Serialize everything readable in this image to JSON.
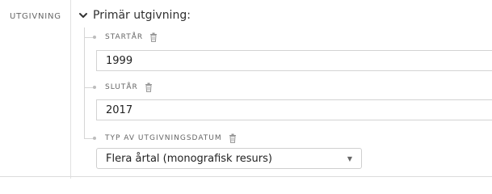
{
  "left": {
    "section_label": "UTGIVNING"
  },
  "section": {
    "title": "Primär utgivning:",
    "toggle_icon": "chevron-down-icon"
  },
  "fields": {
    "start_year": {
      "label": "STARTÅR",
      "value": "1999",
      "delete_icon": "trash-icon"
    },
    "end_year": {
      "label": "SLUTÅR",
      "value": "2017",
      "delete_icon": "trash-icon"
    },
    "date_type": {
      "label": "TYP AV UTGIVNINGSDATUM",
      "selected": "Flera årtal (monografisk resurs)",
      "delete_icon": "trash-icon",
      "dropdown_icon": "caret-down-icon"
    }
  }
}
